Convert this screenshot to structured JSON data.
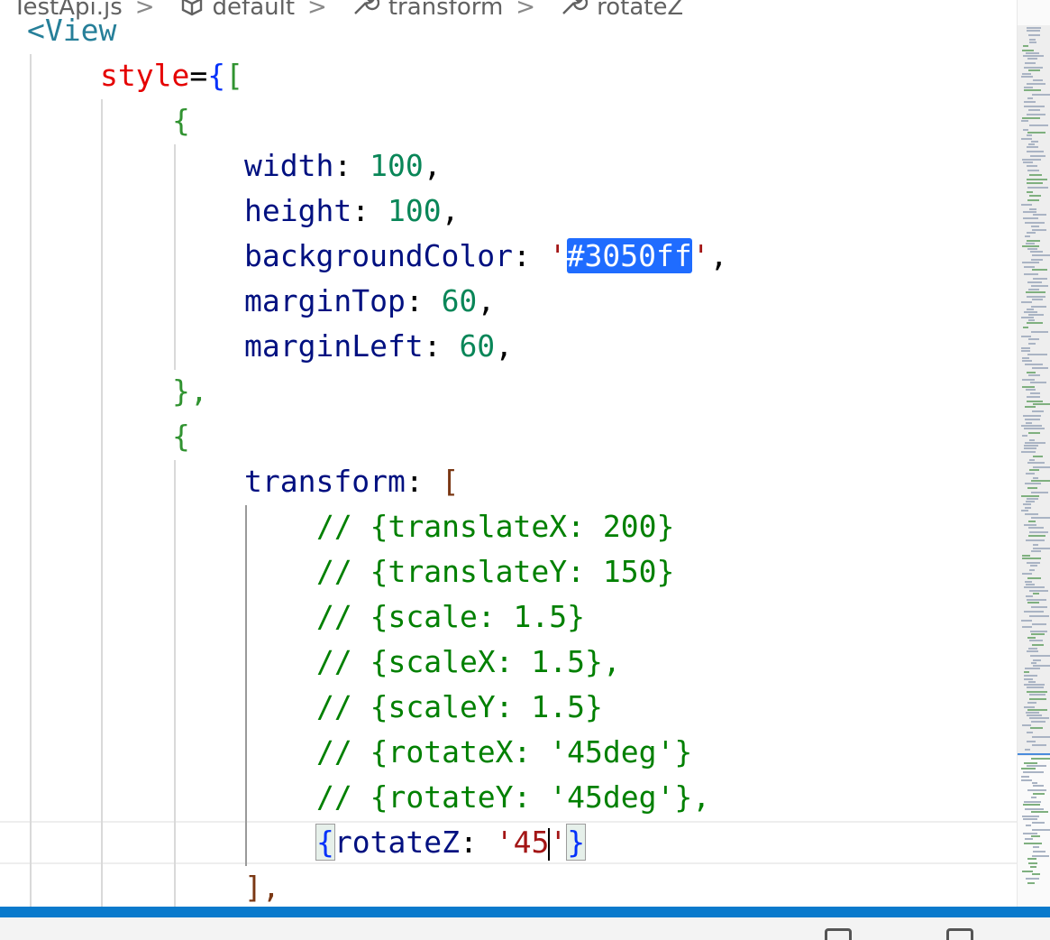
{
  "breadcrumb": {
    "file": "TestApi.js",
    "items": [
      "default",
      "transform",
      "rotateZ"
    ],
    "separator": ">"
  },
  "editor": {
    "open_tag": "<View",
    "style_key": "style",
    "eq": "=",
    "open_brace": "{",
    "open_bracket": "[",
    "obj_open": "{",
    "obj_close": "},",
    "width_key": "width",
    "width_val": "100",
    "height_key": "height",
    "height_val": "100",
    "bg_key": "backgroundColor",
    "bg_val": "#3050ff",
    "margin_top_key": "marginTop",
    "margin_top_val": "60",
    "margin_left_key": "marginLeft",
    "margin_left_val": "60",
    "transform_key": "transform",
    "comments": [
      "// {translateX: 200}",
      "// {translateY: 150}",
      "// {scale: 1.5}",
      "// {scaleX: 1.5},",
      "// {scaleY: 1.5}",
      "// {rotateX: '45deg'}",
      "// {rotateY: '45deg'},"
    ],
    "rotate_key": "rotateZ",
    "rotate_val_typed": "'45",
    "rotate_val_close": "'",
    "close_bracket": "],",
    "colon": ": ",
    "comma": ","
  },
  "colors": {
    "selection": "#1f6cff",
    "status_bar": "#0a7acc"
  },
  "icons": [
    "cube-icon",
    "wrench-icon",
    "wrench-icon"
  ]
}
